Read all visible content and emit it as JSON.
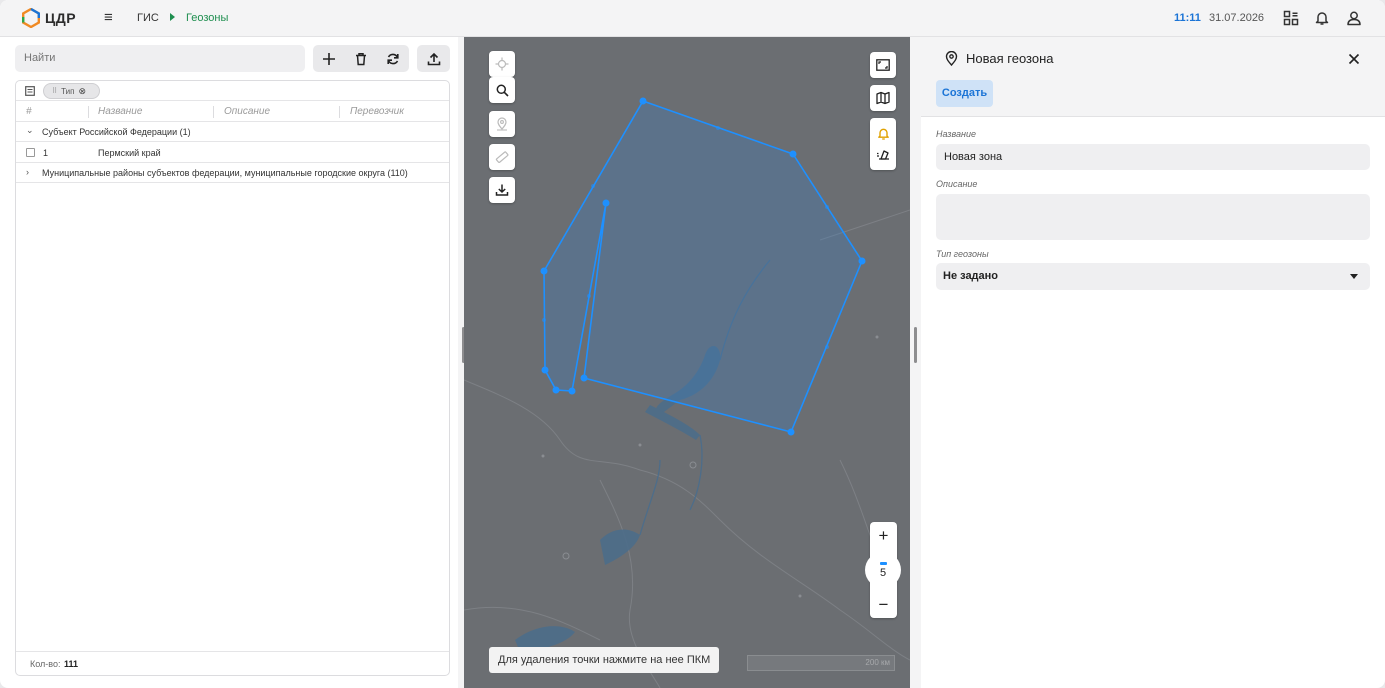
{
  "header": {
    "logo_text": "ЦДР",
    "breadcrumb": [
      "ГИС",
      "Геозоны"
    ],
    "time": "11:11",
    "date": "31.07.2026",
    "accent_color": "#1b74d6",
    "crumb_active_color": "#1e8e4f"
  },
  "left": {
    "search_placeholder": "Найти",
    "group_chip": "Тип",
    "columns": [
      "#",
      "Название",
      "Описание",
      "Перевозчик"
    ],
    "group1_label": "Субъект Российской Федерации (1)",
    "row1_num": "1",
    "row1_name": "Пермский край",
    "group2_label": "Муниципальные районы субъектов федерации, муниципальные городские округа (110)",
    "count_label": "Кол-во:",
    "count_value": "111"
  },
  "map": {
    "zoom_level": "5",
    "hint": "Для удаления точки нажмите на нее ПКМ",
    "scale_label": "200 км",
    "polygon_color": "#1e90ff"
  },
  "right": {
    "title": "Новая геозона",
    "create_label": "Создать",
    "name_label": "Название",
    "name_value": "Новая зона",
    "desc_label": "Описание",
    "desc_value": "",
    "type_label": "Тип геозоны",
    "type_value": "Не задано"
  }
}
